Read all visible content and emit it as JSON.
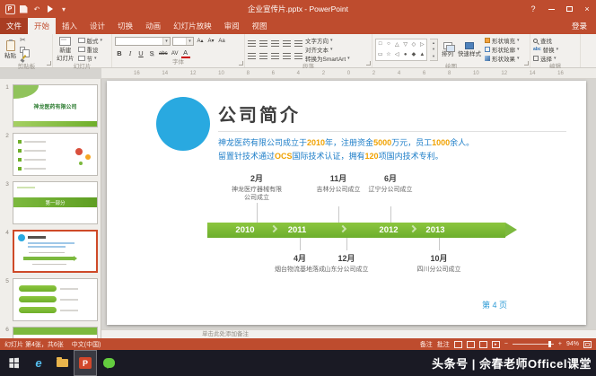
{
  "icons": {
    "help": "?",
    "close": "×",
    "undo": "↶",
    "dropdown": "▾",
    "ppt": "P",
    "ie": "e",
    "minus": "−",
    "plus": "+",
    "play": "▸",
    "bold": "B",
    "italic": "I",
    "underline": "U",
    "shadow": "S",
    "strike": "abc",
    "spacing": "AV",
    "case": "Aa",
    "fontcolor": "A",
    "grow": "A▴",
    "shrink": "A▾",
    "shapes": [
      "□",
      "○",
      "△",
      "▽",
      "◇",
      "▷",
      "▭",
      "☆",
      "◁",
      "●",
      "◆",
      "▲"
    ],
    "gal_up": "▴",
    "gal_down": "▾"
  },
  "titlebar": {
    "title": "企业宣传片.pptx - PowerPoint",
    "signin": "登录"
  },
  "tabs": [
    "文件",
    "开始",
    "插入",
    "设计",
    "切换",
    "动画",
    "幻灯片放映",
    "审阅",
    "视图"
  ],
  "ribbon": {
    "clipboard": {
      "group": "剪贴板",
      "paste": "粘贴"
    },
    "slides": {
      "group": "幻灯片",
      "new1": "新建",
      "new2": "幻灯片",
      "layout": "版式",
      "reset": "重设",
      "section": "节"
    },
    "font": {
      "group": "字体"
    },
    "paragraph": {
      "group": "段落",
      "dir": "文字方向",
      "align": "对齐文本",
      "smartart": "转换为SmartArt"
    },
    "drawing": {
      "group": "绘图",
      "arrange": "排列",
      "styles": "快速样式",
      "fill": "形状填充",
      "outline": "形状轮廓",
      "effects": "形状效果"
    },
    "editing": {
      "group": "编辑",
      "find": "查找",
      "replace": "替换",
      "select": "选择"
    }
  },
  "ruler": [
    "16",
    "14",
    "12",
    "10",
    "8",
    "6",
    "4",
    "2",
    "0",
    "2",
    "4",
    "6",
    "8",
    "10",
    "12",
    "14",
    "16"
  ],
  "thumbnails": {
    "n1": "1",
    "n2": "2",
    "n3": "3",
    "n4": "4",
    "n5": "5",
    "n6": "6",
    "t1_title": "神龙医药有限公司",
    "t3_banner": "第一部分"
  },
  "slide": {
    "title": "公司简介",
    "body": {
      "l1a": "神龙医药有限公司成立于",
      "l1n1": "2010",
      "l1b": "年，注册资金",
      "l1n2": "5000",
      "l1c": "万元，员工",
      "l1n3": "1000",
      "l1d": "余人。",
      "l2a": "留置针技术通过",
      "l2n1": "OCS",
      "l2b": "国际技术认证，拥有",
      "l2n2": "120",
      "l2c": "项国内技术专利。"
    },
    "timeline": {
      "years": [
        "2010",
        "2011",
        "2012",
        "2013"
      ],
      "top": [
        {
          "m": "2月",
          "l": "神龙医疗器械有限公司成立"
        },
        {
          "m": "11月",
          "l": "吉林分公司成立"
        },
        {
          "m": "6月",
          "l": "辽宁分公司成立"
        }
      ],
      "bottom": [
        {
          "m": "4月",
          "l": "烟台物流基地落成"
        },
        {
          "m": "12月",
          "l": "山东分公司成立"
        },
        {
          "m": "10月",
          "l": "四川分公司成立"
        }
      ]
    },
    "page": "第 4 页"
  },
  "notes": "单击此处添加备注",
  "statusbar": {
    "slide_info": "幻灯片 第4张，共6张",
    "language": "中文(中国)",
    "notes_btn": "备注",
    "comments_btn": "批注",
    "zoom": "94%"
  },
  "taskbar": {
    "watermark": "头条号 | 佘春老师Officel课堂"
  }
}
